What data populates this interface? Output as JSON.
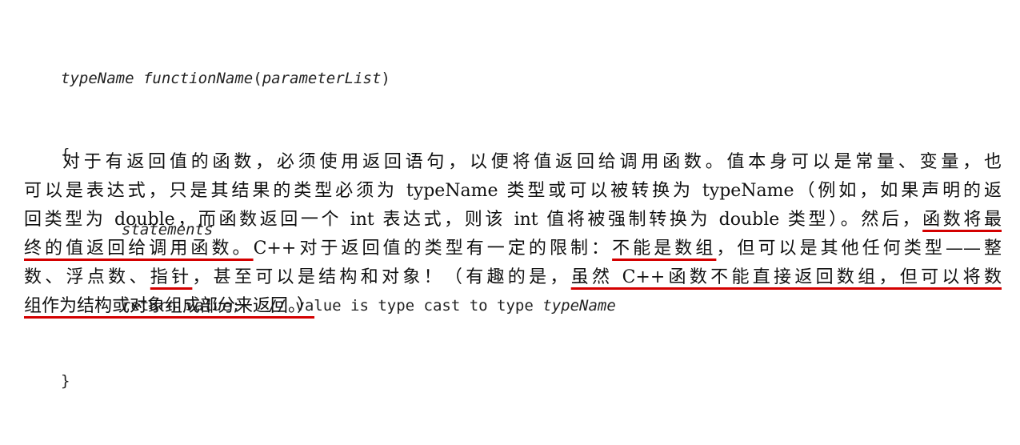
{
  "code": {
    "signature_type": "typeName",
    "signature_name": "functionName",
    "signature_params": "parameterList",
    "open_brace": "{",
    "statements": "statements",
    "return_keyword": "return",
    "return_value": "value",
    "return_semicolon": ";",
    "comment": "// value is type cast to type",
    "comment_type": "typeName",
    "close_brace": "}"
  },
  "paragraph": {
    "line1": "对于有返回值的函数，必须使用返回语句，以便将值返回给调用函数。值本身可以是常量、变量，也",
    "line2": "可以是表达式，只是其结果的类型必须为 typeName 类型或可以被转换为 typeName（例如，如果声明的返",
    "line3_a": "回类型为 double，而函数返回一个 int 表达式，则该 int 值将被强制转换为 double 类型）。然后，",
    "line3_b": "函数将最",
    "line4_a": "终的值返回给调用函数。",
    "line4_b": "C++对于返回值的类型有一定的限制：",
    "line4_c": "不能是数组",
    "line4_d": "，但可以是其他任何类型——整",
    "line5_a": "数、浮点数、",
    "line5_b": "指针",
    "line5_c": "，甚至可以是结构和对象！（有趣的是，",
    "line5_d": "虽然 C++函数不能直接返回数组，但可以将数",
    "line6_a": "组作为结构或对象组成部分来返回。）"
  }
}
